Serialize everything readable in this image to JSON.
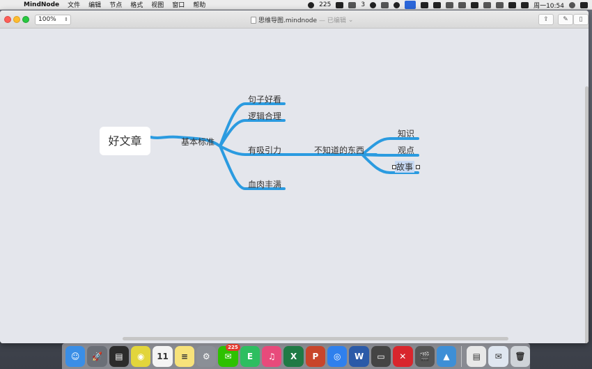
{
  "menubar": {
    "app_name": "MindNode",
    "items": [
      "文件",
      "编辑",
      "节点",
      "格式",
      "视图",
      "窗口",
      "帮助"
    ],
    "wechat_count": "225",
    "ai_count": "3",
    "clock": "周一10:54"
  },
  "toolbar": {
    "zoom_value": "100%",
    "document_name": "思维导图.mindnode",
    "document_status": "— 已编辑"
  },
  "mindmap": {
    "root": "好文章",
    "level1": "基本标准",
    "branches": [
      "句子好看",
      "逻辑合理",
      "有吸引力",
      "血肉丰满"
    ],
    "sub_branch": "不知道的东西",
    "leaves": [
      "知识",
      "观点",
      "故事"
    ],
    "line_color": "#2b9be0"
  },
  "dock": {
    "apps": [
      {
        "name": "finder",
        "color": "#3a8ee6",
        "glyph": "☺"
      },
      {
        "name": "launchpad",
        "color": "#6b6f77",
        "glyph": "🚀"
      },
      {
        "name": "activity",
        "color": "#2c2c2c",
        "glyph": "▤"
      },
      {
        "name": "chrome",
        "color": "#e2d53b",
        "glyph": "◉"
      },
      {
        "name": "calendar",
        "color": "#f4f4f4",
        "glyph": "11"
      },
      {
        "name": "notes",
        "color": "#f7e27a",
        "glyph": "≡"
      },
      {
        "name": "preferences",
        "color": "#8b8f96",
        "glyph": "⚙"
      },
      {
        "name": "wechat",
        "color": "#2dc100",
        "glyph": "✉",
        "badge": "225"
      },
      {
        "name": "evernote",
        "color": "#2dbe60",
        "glyph": "E"
      },
      {
        "name": "music",
        "color": "#e84a7b",
        "glyph": "♫"
      },
      {
        "name": "excel",
        "color": "#1f7a45",
        "glyph": "X"
      },
      {
        "name": "powerpoint",
        "color": "#c8452b",
        "glyph": "P"
      },
      {
        "name": "safari",
        "color": "#2f80ed",
        "glyph": "◎"
      },
      {
        "name": "word",
        "color": "#2b5aa8",
        "glyph": "W"
      },
      {
        "name": "drive",
        "color": "#444",
        "glyph": "▭"
      },
      {
        "name": "xmind",
        "color": "#d8262d",
        "glyph": "✕"
      },
      {
        "name": "video",
        "color": "#555",
        "glyph": "🎬"
      },
      {
        "name": "keynote",
        "color": "#3e8fd6",
        "glyph": "▲"
      },
      {
        "name": "document",
        "color": "#e8e8e8",
        "glyph": "▤"
      },
      {
        "name": "mail",
        "color": "#dfe6f0",
        "glyph": "✉"
      },
      {
        "name": "trash",
        "color": "#cfd3d8",
        "glyph": "🗑"
      }
    ]
  }
}
